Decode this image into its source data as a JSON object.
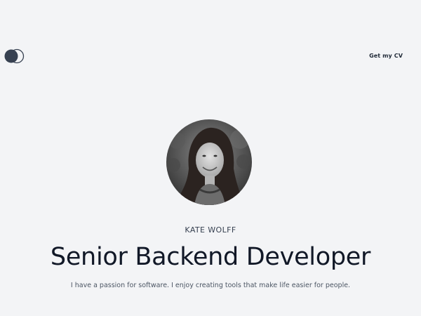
{
  "header": {
    "logo_icon": "two-overlapping-circles-logo-icon",
    "cv_link_label": "Get my CV"
  },
  "profile": {
    "avatar_icon": "profile-photo",
    "name": "KATE WOLFF",
    "headline": "Senior Backend Developer",
    "tagline": "I have a passion for software. I enjoy creating tools that make life easier for people."
  },
  "colors": {
    "background": "#f3f4f6",
    "text_dark": "#111827",
    "logo_fill": "#374151"
  }
}
